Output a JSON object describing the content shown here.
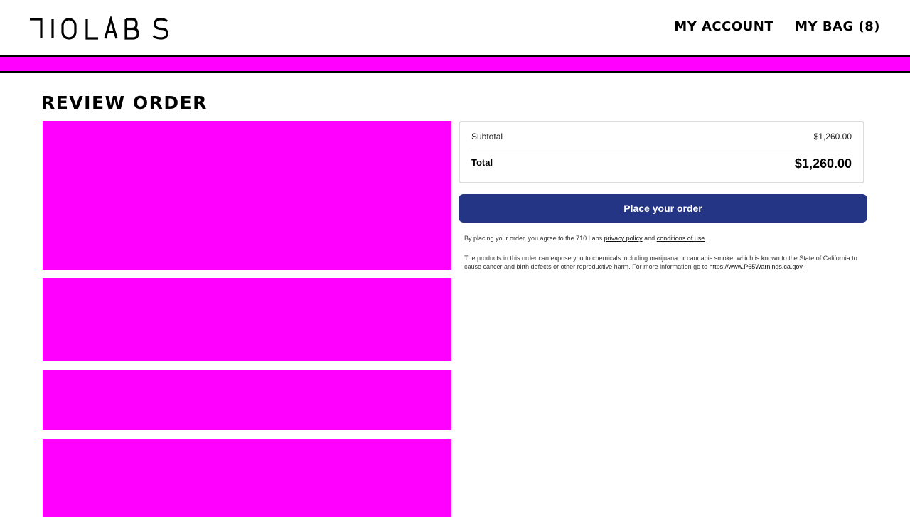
{
  "brand": {
    "logo_text": "710LABS",
    "accent_color": "#ff00ff",
    "button_color": "#253586"
  },
  "nav": {
    "account_label": "MY ACCOUNT",
    "bag_label": "MY BAG (8)"
  },
  "page": {
    "title": "REVIEW ORDER"
  },
  "summary": {
    "subtotal_label": "Subtotal",
    "subtotal_value": "$1,260.00",
    "total_label": "Total",
    "total_value": "$1,260.00"
  },
  "actions": {
    "place_order_label": "Place your order"
  },
  "legal": {
    "agree_prefix": "By placing your order, you agree to the 710 Labs ",
    "privacy_link": "privacy policy",
    "and_text": " and ",
    "conditions_link": "conditions of use",
    "agree_suffix": ".",
    "prop65_text": "The products in this order can expose you to chemicals including marijuana or cannabis smoke, which is known to the State of California to cause cancer and birth defects or other reproductive harm. For more information go to ",
    "prop65_link": "https://www.P65Warnings.ca.gov"
  }
}
